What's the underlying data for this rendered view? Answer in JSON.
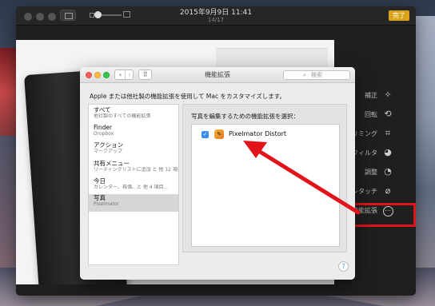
{
  "photos_window": {
    "title": "2015年9月9日 11:41",
    "subtitle": "14/17",
    "done_label": "完了"
  },
  "tools": [
    {
      "label": "補正",
      "icon": "magic-wand-icon",
      "glyph": "✧"
    },
    {
      "label": "回転",
      "icon": "rotate-icon",
      "glyph": "⟲"
    },
    {
      "label": "トリミング",
      "icon": "crop-icon",
      "glyph": "⌗"
    },
    {
      "label": "フィルタ",
      "icon": "filter-icon",
      "glyph": "◕"
    },
    {
      "label": "調整",
      "icon": "adjust-icon",
      "glyph": "◔"
    },
    {
      "label": "レタッチ",
      "icon": "bandage-icon",
      "glyph": "⌀"
    },
    {
      "label": "機能拡張",
      "icon": "more-icon",
      "glyph": "⋯"
    }
  ],
  "prefs": {
    "title": "機能拡張",
    "search_placeholder": "検索",
    "search_glyph": "⌕",
    "description": "Apple または他社製の機能拡張を使用して Mac をカスタマイズします。",
    "back_glyph": "‹",
    "forward_glyph": "›",
    "grid_glyph": "⠿",
    "help_label": "?",
    "categories": [
      {
        "name": "すべて",
        "sub": "他社製のすべての機能拡張"
      },
      {
        "name": "Finder",
        "sub": "Dropbox"
      },
      {
        "name": "アクション",
        "sub": "マークアップ"
      },
      {
        "name": "共有メニュー",
        "sub": "リーディングリストに追加 と 他 12 項目..."
      },
      {
        "name": "今日",
        "sub": "カレンダー、株価、と 他 4 項目..."
      },
      {
        "name": "写真",
        "sub": "Pixelmator"
      }
    ],
    "pane_heading": "写真を編集するための機能拡張を選択：",
    "extensions": [
      {
        "name": "Pixelmator Distort",
        "checked": true,
        "check_glyph": "✓",
        "icon_glyph": "✎"
      }
    ]
  },
  "colors": {
    "annotation_red": "#e0141a",
    "accent_blue": "#3b8ef0",
    "done_yellow": "#d9a419"
  }
}
